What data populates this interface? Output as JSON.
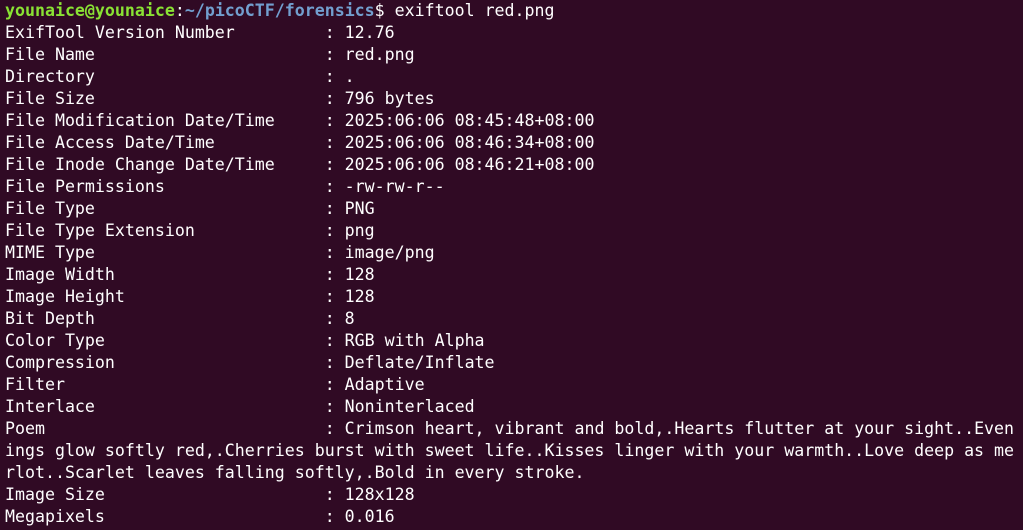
{
  "prompt": {
    "user_host": "younaice@younaice",
    "separator": ":",
    "path": "~/picoCTF/forensics",
    "dollar": "$ ",
    "command": "exiftool red.png"
  },
  "rows": [
    {
      "key": "ExifTool Version Number         ",
      "value": ": 12.76"
    },
    {
      "key": "File Name                       ",
      "value": ": red.png"
    },
    {
      "key": "Directory                       ",
      "value": ": ."
    },
    {
      "key": "File Size                       ",
      "value": ": 796 bytes"
    },
    {
      "key": "File Modification Date/Time     ",
      "value": ": 2025:06:06 08:45:48+08:00"
    },
    {
      "key": "File Access Date/Time           ",
      "value": ": 2025:06:06 08:46:34+08:00"
    },
    {
      "key": "File Inode Change Date/Time     ",
      "value": ": 2025:06:06 08:46:21+08:00"
    },
    {
      "key": "File Permissions                ",
      "value": ": -rw-rw-r--"
    },
    {
      "key": "File Type                       ",
      "value": ": PNG"
    },
    {
      "key": "File Type Extension             ",
      "value": ": png"
    },
    {
      "key": "MIME Type                       ",
      "value": ": image/png"
    },
    {
      "key": "Image Width                     ",
      "value": ": 128"
    },
    {
      "key": "Image Height                    ",
      "value": ": 128"
    },
    {
      "key": "Bit Depth                       ",
      "value": ": 8"
    },
    {
      "key": "Color Type                      ",
      "value": ": RGB with Alpha"
    },
    {
      "key": "Compression                     ",
      "value": ": Deflate/Inflate"
    },
    {
      "key": "Filter                          ",
      "value": ": Adaptive"
    },
    {
      "key": "Interlace                       ",
      "value": ": Noninterlaced"
    }
  ],
  "poem": {
    "key": "Poem                            ",
    "value": ": Crimson heart, vibrant and bold,.Hearts flutter at your sight..Evenings glow softly red,.Cherries burst with sweet life..Kisses linger with your warmth..Love deep as merlot..Scarlet leaves falling softly,.Bold in every stroke."
  },
  "tail_rows": [
    {
      "key": "Image Size                      ",
      "value": ": 128x128"
    },
    {
      "key": "Megapixels                      ",
      "value": ": 0.016"
    }
  ],
  "colors": {
    "background": "#300a24",
    "user_host": "#8ae234",
    "path": "#729fcf",
    "text": "#ffffff"
  }
}
